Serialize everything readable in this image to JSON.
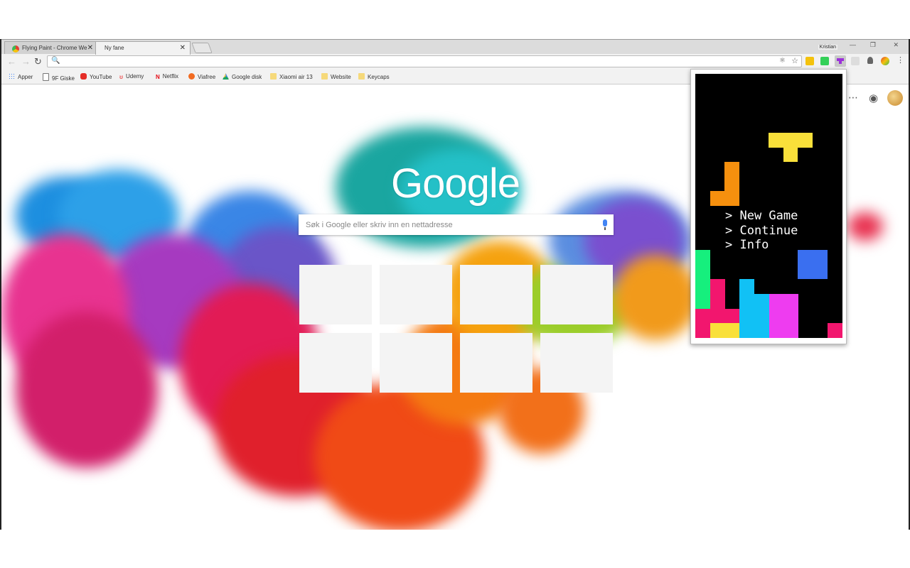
{
  "tabs": [
    {
      "title": "Flying Paint - Chrome We",
      "active": false
    },
    {
      "title": "Ny fane",
      "active": true
    }
  ],
  "profile_name": "Kristian",
  "window_controls": {
    "minimize": "—",
    "restore": "❐",
    "close": "✕"
  },
  "nav": {
    "back": "←",
    "forward": "→",
    "reload": "↻"
  },
  "omnibox": {
    "value": "",
    "placeholder": ""
  },
  "bookmarks": [
    {
      "label": "Apper",
      "icon": "apps-icon",
      "color": "#4285f4"
    },
    {
      "label": "9F Giske",
      "icon": "page-icon",
      "color": "#ffffff"
    },
    {
      "label": "YouTube",
      "icon": "youtube-icon",
      "color": "#e52d27"
    },
    {
      "label": "Udemy",
      "icon": "udemy-icon",
      "color": "#ec5252"
    },
    {
      "label": "Netflix",
      "icon": "netflix-icon",
      "color": "#e50914"
    },
    {
      "label": "Viafree",
      "icon": "viafree-icon",
      "color": "#f26b21"
    },
    {
      "label": "Google disk",
      "icon": "drive-icon",
      "color": "#1fa463"
    },
    {
      "label": "Xiaomi air 13",
      "icon": "folder-icon",
      "color": "#f6d97a"
    },
    {
      "label": "Website",
      "icon": "folder-icon",
      "color": "#f6d97a"
    },
    {
      "label": "Keycaps",
      "icon": "folder-icon",
      "color": "#f6d97a"
    }
  ],
  "newtab": {
    "logo": "Google",
    "search_placeholder": "Søk i Google eller skriv inn en nettadresse"
  },
  "popup": {
    "menu": [
      "> New Game",
      "> Continue",
      "> Info"
    ]
  },
  "colors": {
    "tetris_yellow": "#f9e03a",
    "tetris_orange": "#f6900e",
    "tetris_green": "#16ef7d",
    "tetris_pink": "#f2166e",
    "tetris_cyan": "#11c1f5",
    "tetris_magenta": "#ee3cf0",
    "tetris_blue": "#3a6ff0"
  }
}
